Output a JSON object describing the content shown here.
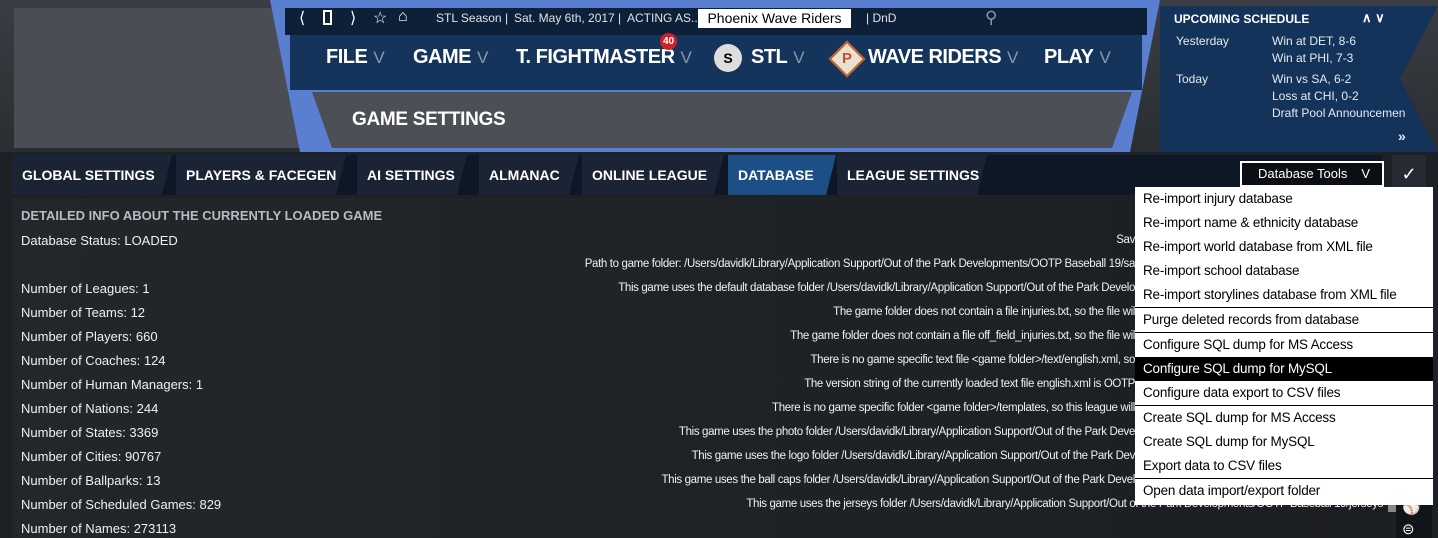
{
  "topbar": {
    "season": "STL Season",
    "date": "Sat. May 6th, 2017",
    "acting": "ACTING AS...",
    "team": "Phoenix Wave Riders",
    "user": "| DnD"
  },
  "nav": {
    "items": [
      {
        "label": "FILE"
      },
      {
        "label": "GAME"
      },
      {
        "label": "T. FIGHTMASTER",
        "badge": "40"
      },
      {
        "label": "STL",
        "logo": "S"
      },
      {
        "label": "WAVE RIDERS",
        "logo": "P"
      },
      {
        "label": "PLAY"
      }
    ]
  },
  "page_title": "GAME SETTINGS",
  "schedule": {
    "title": "UPCOMING SCHEDULE",
    "yesterday": "Yesterday",
    "today": "Today",
    "y1": "Win at DET, 8-6",
    "y2": "Win at PHI, 7-3",
    "t1": "Win vs SA, 6-2",
    "t2": "Loss at CHI, 0-2",
    "t3": "Draft Pool Announcemen"
  },
  "tabs": [
    "GLOBAL SETTINGS",
    "PLAYERS & FACEGEN",
    "AI SETTINGS",
    "ALMANAC",
    "ONLINE LEAGUE",
    "DATABASE",
    "LEAGUE SETTINGS"
  ],
  "active_tab": "DATABASE",
  "db_tools": "Database Tools",
  "content": {
    "heading": "DETAILED INFO ABOUT THE CURRENTLY LOADED GAME",
    "status": "Database Status: LOADED",
    "stats": [
      "Number of Leagues: 1",
      "Number of Teams: 12",
      "Number of Players: 660",
      "Number of Coaches: 124",
      "Number of Human Managers: 1",
      "Number of Nations: 244",
      "Number of States: 3369",
      "Number of Cities: 90767",
      "Number of Ballparks: 13",
      "Number of Scheduled Games: 829",
      "Number of Names: 273113"
    ],
    "info": [
      "Sav",
      "Path to game folder: /Users/davidk/Library/Application Support/Out of the Park Developments/OOTP Baseball 19/sa",
      "This game uses the default database folder /Users/davidk/Library/Application Support/Out of the Park Develo",
      "The game folder does not contain a file injuries.txt, so the file wil",
      "The game folder does not contain a file off_field_injuries.txt, so the file wil",
      "There is no game specific text file <game folder>/text/english.xml, so",
      "The version string of the currently loaded text file english.xml is OOTP",
      "There is no game specific folder <game folder>/templates, so this league will",
      "This game uses the photo folder /Users/davidk/Library/Application Support/Out of the Park Deve",
      "This game uses the logo folder /Users/davidk/Library/Application Support/Out of the Park Dev",
      "This game uses the ball caps folder /Users/davidk/Library/Application Support/Out of the Park Devel",
      "This game uses the jerseys folder /Users/davidk/Library/Application Support/Out of the Park Developments/OOTP Baseball 19/jerseys"
    ]
  },
  "menu": {
    "groups": [
      [
        "Re-import injury database",
        "Re-import name & ethnicity database",
        "Re-import world database from XML file",
        "Re-import school database",
        "Re-import storylines database from XML file"
      ],
      [
        "Purge deleted records from database"
      ],
      [
        "Configure SQL dump for MS Access",
        "Configure SQL dump for MySQL",
        "Configure data export to CSV files"
      ],
      [
        "Create SQL dump for MS Access",
        "Create SQL dump for MySQL",
        "Export data to CSV files"
      ],
      [
        "Open data import/export folder"
      ]
    ],
    "highlighted": "Configure SQL dump for MySQL"
  },
  "colors": {
    "accent": "#1b4f86",
    "frame": "#5a7fd0",
    "navy": "#15345c"
  }
}
